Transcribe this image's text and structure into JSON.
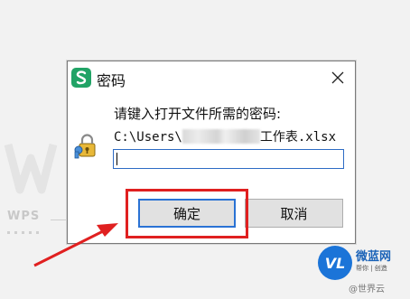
{
  "background": {
    "brand_text": "WPS"
  },
  "dialog": {
    "title": "密码",
    "app_icon_glyph": "S",
    "close_glyph": "✕",
    "prompt": "请键入打开文件所需的密码:",
    "file_path_prefix": "C:\\Users\\",
    "file_path_suffix": "工作表.xlsx",
    "password_value": "",
    "ok_label": "确定",
    "cancel_label": "取消"
  },
  "watermark": {
    "logo_text": "VL",
    "name": "微蓝网",
    "sub": "帮你 | 创造",
    "credit": "@世界云"
  },
  "colors": {
    "accent_blue": "#2a72d4",
    "annotation_red": "#e02020",
    "app_green": "#21a366"
  },
  "icons": [
    "wps-spreadsheet-icon",
    "close-icon",
    "key-lock-icon",
    "red-arrow-icon"
  ]
}
